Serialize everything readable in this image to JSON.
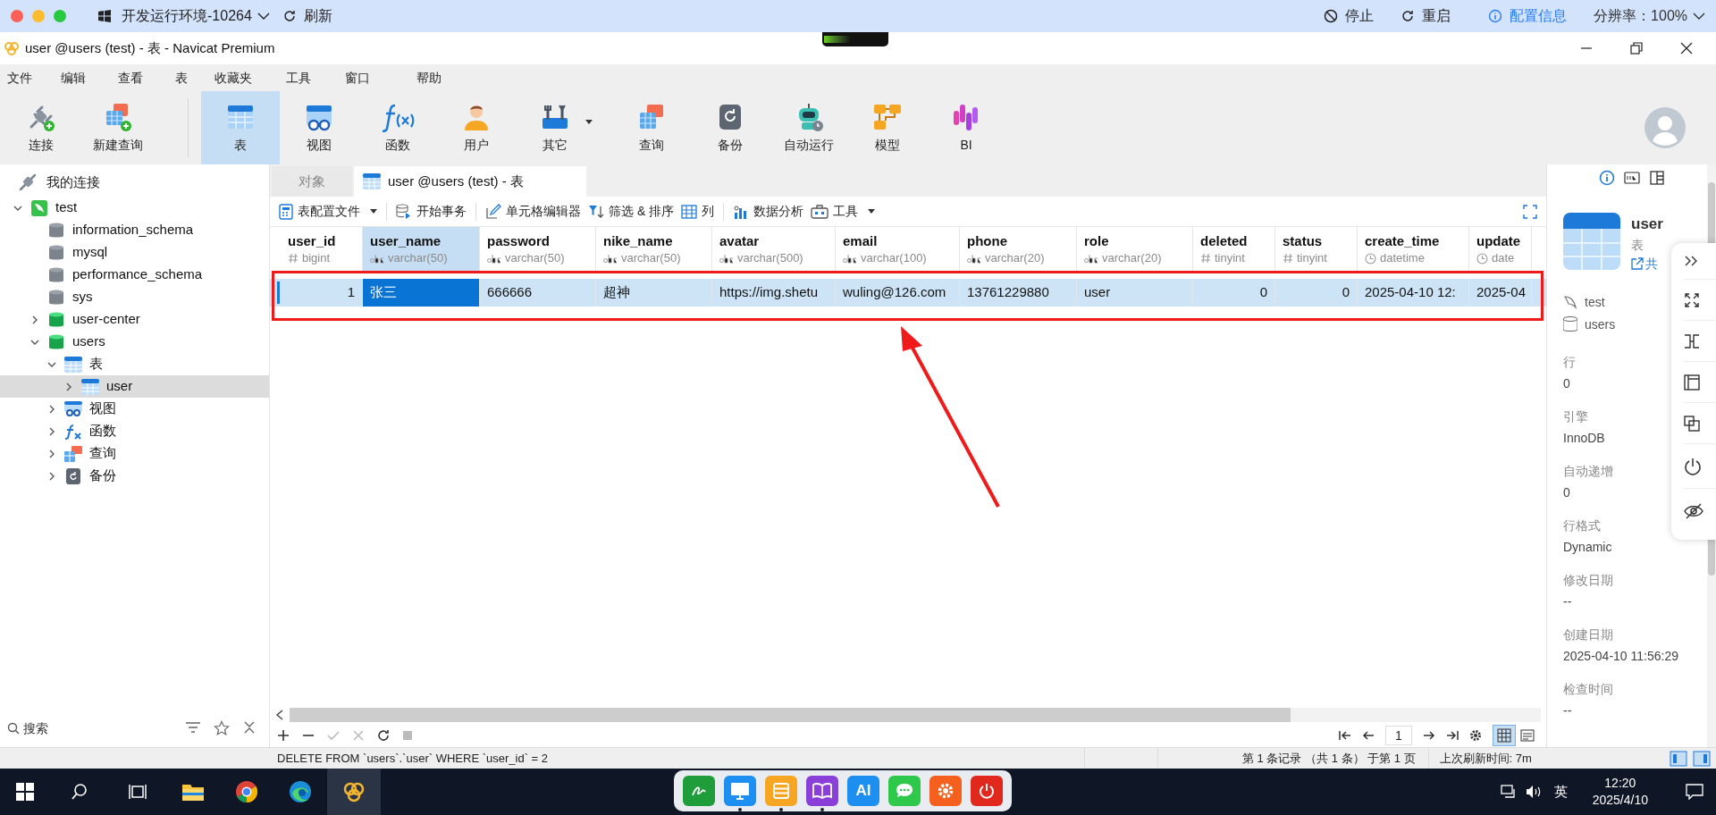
{
  "top_bar": {
    "environment": "开发运行环境-10264",
    "refresh": "刷新",
    "actions": [
      {
        "label": "停止",
        "kind": "stop"
      },
      {
        "label": "重启",
        "kind": "restart"
      },
      {
        "label": "配置信息",
        "kind": "info"
      }
    ],
    "resolution": "分辨率：100%"
  },
  "window": {
    "title": "user @users (test) - 表 - Navicat Premium"
  },
  "menu": [
    "文件",
    "编辑",
    "查看",
    "表",
    "收藏夹",
    "工具",
    "窗口",
    "帮助"
  ],
  "toolbar": [
    {
      "label": "连接",
      "selected": false,
      "dropdown": false
    },
    {
      "label": "新建查询",
      "selected": false,
      "dropdown": false
    },
    {
      "label": "表",
      "selected": true,
      "dropdown": false
    },
    {
      "label": "视图",
      "selected": false,
      "dropdown": false
    },
    {
      "label": "函数",
      "selected": false,
      "dropdown": false
    },
    {
      "label": "用户",
      "selected": false,
      "dropdown": false
    },
    {
      "label": "其它",
      "selected": false,
      "dropdown": true
    },
    {
      "label": "查询",
      "selected": false,
      "dropdown": false
    },
    {
      "label": "备份",
      "selected": false,
      "dropdown": false
    },
    {
      "label": "自动运行",
      "selected": false,
      "dropdown": false
    },
    {
      "label": "模型",
      "selected": false,
      "dropdown": false
    },
    {
      "label": "BI",
      "selected": false,
      "dropdown": false
    }
  ],
  "navigator": {
    "header": "我的连接",
    "tree": [
      {
        "label": "test",
        "kind": "connection",
        "expanded": true,
        "selected": false,
        "children": [
          {
            "label": "information_schema",
            "kind": "database",
            "selected": false
          },
          {
            "label": "mysql",
            "kind": "database",
            "selected": false
          },
          {
            "label": "performance_schema",
            "kind": "database",
            "selected": false
          },
          {
            "label": "sys",
            "kind": "database",
            "selected": false
          },
          {
            "label": "user-center",
            "kind": "database-open",
            "expanded": false,
            "selected": false
          },
          {
            "label": "users",
            "kind": "database-open",
            "expanded": true,
            "selected": false,
            "children": [
              {
                "label": "表",
                "kind": "tables",
                "expanded": true,
                "selected": false,
                "children": [
                  {
                    "label": "user",
                    "kind": "table",
                    "expanded": false,
                    "selected": true
                  }
                ]
              },
              {
                "label": "视图",
                "kind": "views",
                "expanded": false,
                "selected": false
              },
              {
                "label": "函数",
                "kind": "functions",
                "expanded": false,
                "selected": false
              },
              {
                "label": "查询",
                "kind": "queries",
                "expanded": false,
                "selected": false
              },
              {
                "label": "备份",
                "kind": "backups",
                "expanded": false,
                "selected": false
              }
            ]
          }
        ]
      }
    ],
    "search": {
      "placeholder": "搜索"
    }
  },
  "tabs": [
    {
      "label": "对象",
      "selected": false
    },
    {
      "label": "user @users (test) - 表",
      "selected": true
    }
  ],
  "grid_toolbar": [
    {
      "label": "表配置文件",
      "dropdown": true
    },
    {
      "label": "开始事务",
      "dropdown": false
    },
    {
      "label": "单元格编辑器",
      "dropdown": false
    },
    {
      "label": "筛选 & 排序",
      "dropdown": false
    },
    {
      "label": "列",
      "dropdown": false
    },
    {
      "label": "数据分析",
      "dropdown": false
    },
    {
      "label": "工具",
      "dropdown": true
    }
  ],
  "table": {
    "columns": [
      {
        "name": "user_id",
        "type": "bigint",
        "kind": "number",
        "selected": false
      },
      {
        "name": "user_name",
        "type": "varchar(50)",
        "kind": "text",
        "selected": true
      },
      {
        "name": "password",
        "type": "varchar(50)",
        "kind": "text",
        "selected": false
      },
      {
        "name": "nike_name",
        "type": "varchar(50)",
        "kind": "text",
        "selected": false
      },
      {
        "name": "avatar",
        "type": "varchar(500)",
        "kind": "text",
        "selected": false
      },
      {
        "name": "email",
        "type": "varchar(100)",
        "kind": "text",
        "selected": false
      },
      {
        "name": "phone",
        "type": "varchar(20)",
        "kind": "text",
        "selected": false
      },
      {
        "name": "role",
        "type": "varchar(20)",
        "kind": "text",
        "selected": false
      },
      {
        "name": "deleted",
        "type": "tinyint",
        "kind": "number",
        "selected": false
      },
      {
        "name": "status",
        "type": "tinyint",
        "kind": "number",
        "selected": false
      },
      {
        "name": "create_time",
        "type": "datetime",
        "kind": "datetime",
        "selected": false
      },
      {
        "name": "update",
        "type": "date",
        "kind": "datetime",
        "selected": false
      }
    ],
    "rows": [
      {
        "selected": true,
        "cells": [
          {
            "text": "1",
            "selected": false
          },
          {
            "text": "张三",
            "selected": true
          },
          {
            "text": "666666",
            "selected": false
          },
          {
            "text": "超神",
            "selected": false
          },
          {
            "text": "https://img.shetu",
            "selected": false
          },
          {
            "text": "wuling@126.com",
            "selected": false
          },
          {
            "text": "13761229880",
            "selected": false
          },
          {
            "text": "user",
            "selected": false
          },
          {
            "text": "0",
            "selected": false
          },
          {
            "text": "0",
            "selected": false
          },
          {
            "text": "2025-04-10 12:",
            "selected": false
          },
          {
            "text": "2025-04",
            "selected": false
          }
        ]
      }
    ]
  },
  "grid_footer": {
    "page": "1",
    "views": [
      {
        "kind": "grid",
        "selected": true
      },
      {
        "kind": "form",
        "selected": false
      }
    ]
  },
  "status_bar": {
    "sql": "DELETE FROM `users`.`user` WHERE `user_id` = 2",
    "record": "第 1 条记录 （共 1 条） 于第 1 页",
    "refreshed": "上次刷新时间: 7m"
  },
  "info_panel": {
    "title": "user",
    "subtitle": "表",
    "share": "共",
    "connection": "test",
    "database": "users",
    "properties": [
      {
        "label": "行",
        "value": "0"
      },
      {
        "label": "引擎",
        "value": "InnoDB"
      },
      {
        "label": "自动递增",
        "value": "0"
      },
      {
        "label": "行格式",
        "value": "Dynamic"
      },
      {
        "label": "修改日期",
        "value": "--"
      },
      {
        "label": "创建日期",
        "value": "2025-04-10 11:56:29"
      },
      {
        "label": "检查时间",
        "value": "--"
      }
    ]
  },
  "taskbar": {
    "pinned": [
      {
        "kind": "explorer",
        "active": false
      },
      {
        "kind": "chrome",
        "active": false
      },
      {
        "kind": "edge",
        "active": false
      },
      {
        "kind": "navicat",
        "active": true
      }
    ],
    "dock": [
      {
        "kind": "sign",
        "running": false
      },
      {
        "kind": "monitor",
        "running": true
      },
      {
        "kind": "list",
        "running": true
      },
      {
        "kind": "book",
        "running": true
      },
      {
        "kind": "ai",
        "text": "AI",
        "running": false
      },
      {
        "kind": "chat",
        "running": false
      },
      {
        "kind": "gear",
        "running": false
      },
      {
        "kind": "power",
        "running": false
      }
    ],
    "ime": "英",
    "time": "12:20",
    "date": "2025/4/10"
  }
}
